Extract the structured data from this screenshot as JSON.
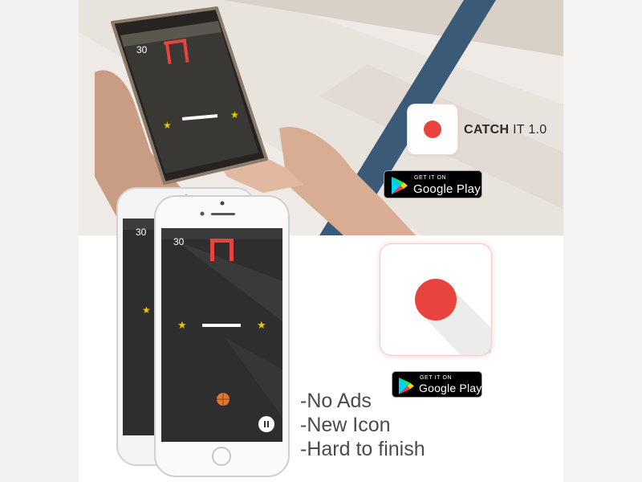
{
  "app": {
    "name": "CATCH",
    "name_suffix": "IT 1.0",
    "brand_color": "#e8433f"
  },
  "store_badge": {
    "get_it_on": "GET IT ON",
    "store": "Google Play"
  },
  "game": {
    "score_back_phone": "30",
    "score_front_phone": "30",
    "score_hand_phone": "30",
    "pause_icon": "pause-icon",
    "ball_icon": "basketball-icon",
    "star_icon": "star-icon",
    "hoop_icon": "goal-hoop-icon"
  },
  "features": [
    "-No Ads",
    "-New Icon",
    "-Hard to finish"
  ],
  "colors": {
    "screen_bg": "#2e2e2e",
    "hoop": "#e8433f",
    "star": "#f2c400",
    "ball": "#e0782c",
    "accent_band": "#3a5a77"
  }
}
